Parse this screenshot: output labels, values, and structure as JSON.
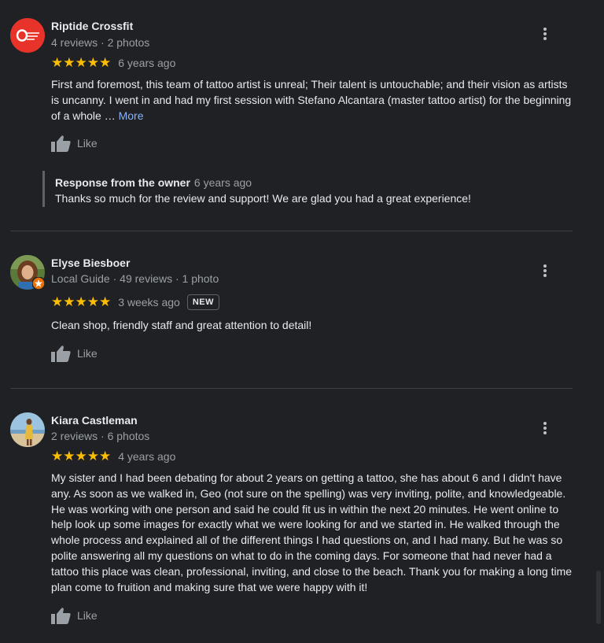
{
  "reviews": [
    {
      "name": "Riptide Crossfit",
      "meta": "4 reviews · 2 photos",
      "stars": "★★★★★",
      "rating": 5,
      "ago": "6 years ago",
      "text": "First and foremost, this team of tattoo artist is unreal; Their talent is untouchable; and their vision as artists is uncanny. I went in and had my first session with Stefano Alcantara (master tattoo artist) for the beginning of a whole … ",
      "more": "More",
      "like": "Like",
      "owner": {
        "title": "Response from the owner",
        "ago": "6 years ago",
        "text": "Thanks so much for the review and support! We are glad you had a great experience!"
      }
    },
    {
      "name": "Elyse Biesboer",
      "meta": "Local Guide · 49 reviews · 1 photo",
      "stars": "★★★★★",
      "rating": 5,
      "ago": "3 weeks ago",
      "badge": "NEW",
      "text": "Clean shop, friendly staff and great attention to detail!",
      "like": "Like"
    },
    {
      "name": "Kiara Castleman",
      "meta": "2 reviews · 6 photos",
      "stars": "★★★★★",
      "rating": 5,
      "ago": "4 years ago",
      "text": "My sister and I had been debating for about 2 years on getting a tattoo, she has about 6 and I didn't have any. As soon as we walked in, Geo (not sure on the spelling) was very inviting, polite, and knowledgeable. He was working with one person and said he could fit us in within the next 20 minutes. He went online to help look up some images for exactly what we were looking for and we started in. He walked through the whole process and explained all of the different things I had questions on, and I had many. But he was so polite answering all my questions on what to do in the coming days. For someone that had never had a tattoo this place was clean, professional, inviting, and close to the beach. Thank you for making a long time plan come to fruition and making sure that we were happy with it!",
      "like": "Like"
    }
  ],
  "colors": {
    "background": "#202124",
    "star": "#fbbc04",
    "link": "#8ab4f8",
    "avatar_riptide": "#e8332a"
  },
  "icons": [
    "thumbs-up-icon",
    "more-vert-icon",
    "local-guide-star-icon"
  ]
}
